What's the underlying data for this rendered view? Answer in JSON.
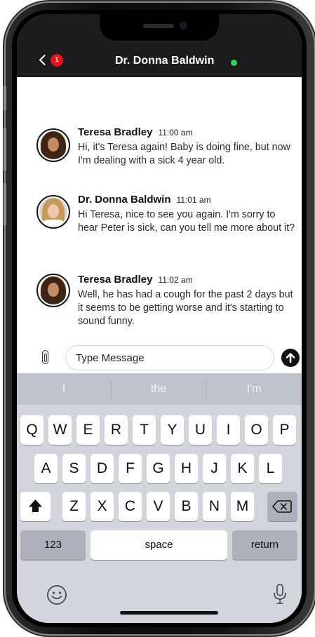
{
  "header": {
    "contact_name": "Dr. Donna Baldwin",
    "unread_count": "1",
    "status_color": "#30d158"
  },
  "messages": [
    {
      "sender": "Teresa Bradley",
      "time": "11:00 am",
      "text": "Hi, it's Teresa again! Baby is doing fine, but now I'm dealing with a sick 4 year old."
    },
    {
      "sender": "Dr. Donna Baldwin",
      "time": "11:01 am",
      "text": "Hi Teresa, nice to see you again. I'm sorry to hear Peter is sick, can you tell me more about it?"
    },
    {
      "sender": "Teresa Bradley",
      "time": "11:02 am",
      "text": "Well, he has had a cough for the past 2 days but it seems to be getting worse and it's starting to sound funny."
    }
  ],
  "composer": {
    "placeholder": "Type Message",
    "value": ""
  },
  "keyboard": {
    "suggestions": [
      "I",
      "the",
      "I'm"
    ],
    "row1": [
      "Q",
      "W",
      "E",
      "R",
      "T",
      "Y",
      "U",
      "I",
      "O",
      "P"
    ],
    "row2": [
      "A",
      "S",
      "D",
      "F",
      "G",
      "H",
      "J",
      "K",
      "L"
    ],
    "row3": [
      "Z",
      "X",
      "C",
      "V",
      "B",
      "N",
      "M"
    ],
    "numbers_label": "123",
    "space_label": "space",
    "return_label": "return"
  },
  "icons": {
    "back": "chevron-left-icon",
    "attach": "paperclip-icon",
    "send": "arrow-up-circle-icon",
    "shift": "shift-icon",
    "delete": "backspace-icon",
    "emoji": "emoji-icon",
    "dictation": "microphone-icon"
  }
}
